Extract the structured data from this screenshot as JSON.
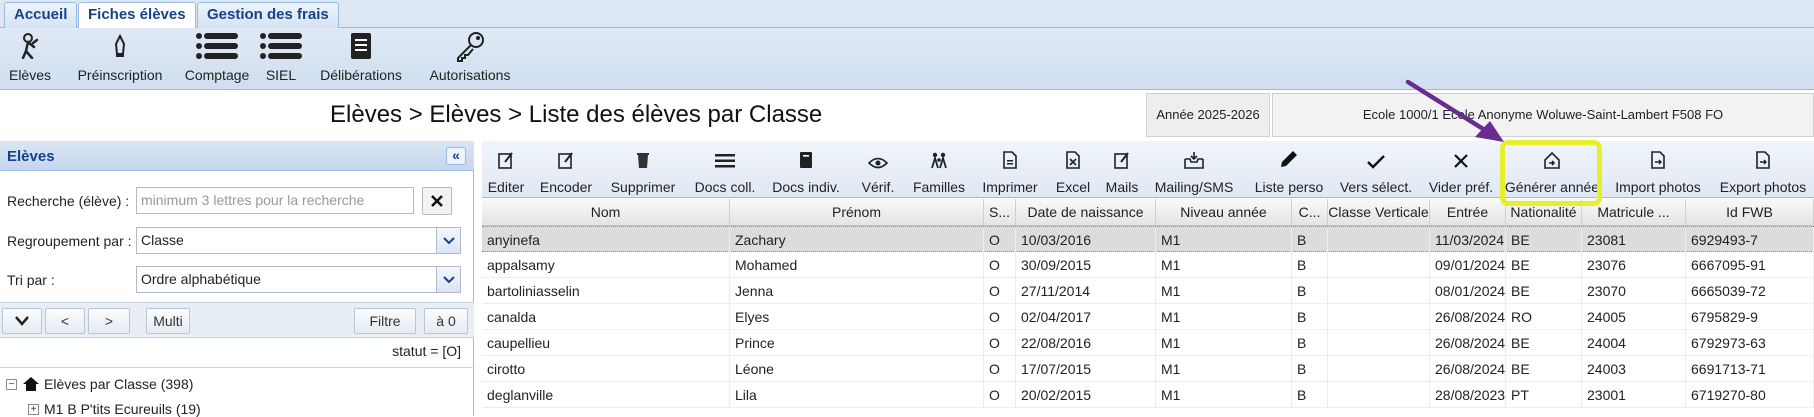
{
  "tabs": [
    {
      "label": "Accueil"
    },
    {
      "label": "Fiches élèves"
    },
    {
      "label": "Gestion des frais"
    }
  ],
  "main_toolbar": [
    {
      "label": "Elèves",
      "icon": "person-icon"
    },
    {
      "label": "Préinscription",
      "icon": "pen-icon"
    },
    {
      "label": "Comptage",
      "icon": "list-icon"
    },
    {
      "label": "SIEL",
      "icon": "list-icon"
    },
    {
      "label": "Délibérations",
      "icon": "notebook-icon"
    },
    {
      "label": "Autorisations",
      "icon": "key-icon"
    }
  ],
  "breadcrumb": "Elèves > Elèves > Liste des élèves par Classe",
  "school_year": "Année 2025-2026",
  "school_info": "Ecole 1000/1 Ecole Anonyme Woluwe-Saint-Lambert F508 FO",
  "left_panel": {
    "title": "Elèves",
    "search_label": "Recherche (élève) :",
    "search_placeholder": "minimum 3 lettres pour la recherche",
    "group_label": "Regroupement par :",
    "group_value": "Classe",
    "sort_label": "Tri par :",
    "sort_value": "Ordre alphabétique",
    "nav": {
      "prev": "<",
      "next": ">",
      "multi": "Multi",
      "filter": "Filtre",
      "reset": "à 0"
    },
    "status": "statut = [O]",
    "tree_root": "Elèves par Classe (398)",
    "tree_child": "M1 B P'tits Ecureuils (19)"
  },
  "grid_toolbar": [
    {
      "label": "Editer",
      "icon": "edit-icon"
    },
    {
      "label": "Encoder",
      "icon": "edit-icon"
    },
    {
      "label": "Supprimer",
      "icon": "trash-icon"
    },
    {
      "label": "Docs coll.",
      "icon": "list-icon"
    },
    {
      "label": "Docs indiv.",
      "icon": "document-icon"
    },
    {
      "label": "Vérif.",
      "icon": "eye-icon"
    },
    {
      "label": "Familles",
      "icon": "family-icon"
    },
    {
      "label": "Imprimer",
      "icon": "document-icon"
    },
    {
      "label": "Excel",
      "icon": "document-icon"
    },
    {
      "label": "Mails",
      "icon": "edit-icon"
    },
    {
      "label": "Mailing/SMS",
      "icon": "inbox-icon"
    },
    {
      "label": "Liste perso",
      "icon": "pencil-icon"
    },
    {
      "label": "Vers sélect.",
      "icon": "check-icon"
    },
    {
      "label": "Vider préf.",
      "icon": "x-icon"
    },
    {
      "label": "Générer année",
      "icon": "generate-icon"
    },
    {
      "label": "Import photos",
      "icon": "document-icon"
    },
    {
      "label": "Export photos",
      "icon": "document-icon"
    }
  ],
  "columns": [
    "Nom",
    "Prénom",
    "S...",
    "Date de naissance",
    "Niveau année",
    "C...",
    "Classe Verticale",
    "Entrée",
    "Nationalité",
    "Matricule ...",
    "Id FWB"
  ],
  "rows": [
    [
      "anyinefa",
      "Zachary",
      "O",
      "10/03/2016",
      "M1",
      "B",
      "",
      "11/03/2024",
      "BE",
      "23081",
      "6929493-7"
    ],
    [
      "appalsamy",
      "Mohamed",
      "O",
      "30/09/2015",
      "M1",
      "B",
      "",
      "09/01/2024",
      "BE",
      "23076",
      "6667095-91"
    ],
    [
      "bartoliniasselin",
      "Jenna",
      "O",
      "27/11/2014",
      "M1",
      "B",
      "",
      "08/01/2024",
      "BE",
      "23070",
      "6665039-72"
    ],
    [
      "canalda",
      "Elyes",
      "O",
      "02/04/2017",
      "M1",
      "B",
      "",
      "26/08/2024",
      "RO",
      "24005",
      "6795829-9"
    ],
    [
      "caupellieu",
      "Prince",
      "O",
      "22/08/2016",
      "M1",
      "B",
      "",
      "26/08/2024",
      "BE",
      "24004",
      "6792973-63"
    ],
    [
      "cirotto",
      "Léone",
      "O",
      "17/07/2015",
      "M1",
      "B",
      "",
      "26/08/2024",
      "BE",
      "24003",
      "6691713-71"
    ],
    [
      "deglanville",
      "Lila",
      "O",
      "20/02/2015",
      "M1",
      "B",
      "",
      "28/08/2023",
      "PT",
      "23001",
      "6719270-80"
    ]
  ],
  "colors": {
    "header_blue": "#15428b",
    "highlight": "#e6f02a",
    "arrow": "#6a2c91"
  }
}
